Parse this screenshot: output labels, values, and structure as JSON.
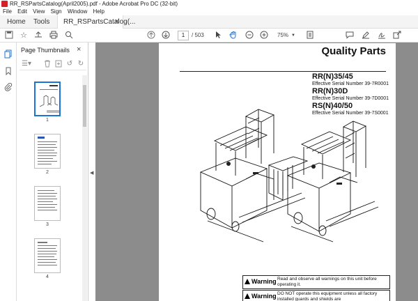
{
  "window": {
    "title": "RR_RSPartsCatalog(April2005).pdf - Adobe Acrobat Pro DC (32-bit)"
  },
  "menu": {
    "items": [
      "File",
      "Edit",
      "View",
      "Sign",
      "Window",
      "Help"
    ]
  },
  "tabs": {
    "home": "Home",
    "tools": "Tools",
    "document": "RR_RSPartsCatalog(...",
    "close_glyph": "×"
  },
  "toolbar": {
    "page_current": "1",
    "page_total": "/ 503",
    "zoom": "75%",
    "icons": [
      "save-icon",
      "bookmark-star-icon",
      "upload-icon",
      "print-icon",
      "search-icon",
      "page-up-icon",
      "page-down-icon",
      "select-cursor-icon",
      "hand-icon",
      "zoom-out-icon",
      "zoom-in-icon",
      "comment-icon",
      "highlight-pen-icon",
      "sign-icon",
      "share-icon"
    ]
  },
  "sidebar": {
    "title": "Page Thumbnails",
    "close_glyph": "×",
    "thumbnails": [
      {
        "label": "1",
        "selected": true
      },
      {
        "label": "2",
        "selected": false
      },
      {
        "label": "3",
        "selected": false
      },
      {
        "label": "4",
        "selected": false
      }
    ]
  },
  "document": {
    "heading": "Quality Parts",
    "models": [
      {
        "name": "RR(N)35/45",
        "serial": "Effective Serial Number 39-7R0001"
      },
      {
        "name": "RR(N)30D",
        "serial": "Effective Serial Number 39-7D0001"
      },
      {
        "name": "RS(N)40/50",
        "serial": "Effective Serial Number 39-7S0001"
      }
    ],
    "warnings": [
      {
        "label": "Warning",
        "text": "Read and observe all warnings on this unit before operating it."
      },
      {
        "label": "Warning",
        "text": "DO NOT operate this equipment unless all factory installed guards and shields are"
      }
    ]
  }
}
